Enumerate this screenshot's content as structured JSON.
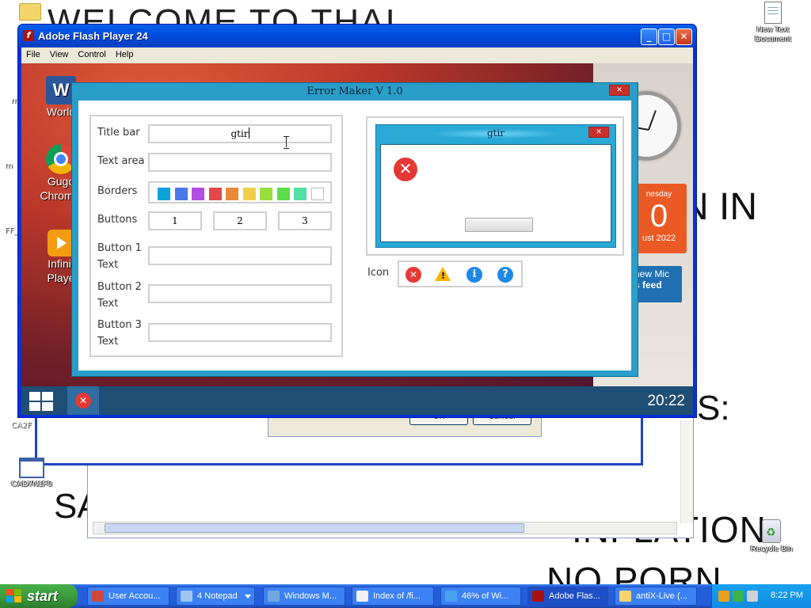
{
  "desktop": {
    "bg_text_top": "WELCOME TO THAI",
    "bg_text_in": "N IN",
    "bg_text_s": "S:",
    "bg_text_sa": "SA",
    "bg_text_inflation": "INFLATION",
    "bg_text_porn": "NO  PORN",
    "icons": {
      "new_text_document": "New Text Document",
      "cad_top": "CA2F",
      "cad": "CAD7N1F9",
      "recycle_bin": "Recycle Bin",
      "edge_m": "m",
      "edge_ff": "FF_"
    }
  },
  "background_dialog": {
    "ok_label": "OK",
    "cancel_label": "Cancel"
  },
  "flash_window": {
    "title": "Adobe Flash Player 24",
    "icon": "f",
    "menu": [
      "File",
      "View",
      "Control",
      "Help"
    ],
    "controls": {
      "minimize": "_",
      "maximize": "□",
      "close": "✕"
    },
    "stage": {
      "word_label": "World",
      "chrome_label": "Gugo Chromiu",
      "player_label": "Infinit Playe",
      "calendar_day": "nesday",
      "calendar_num": "0",
      "calendar_month": "ust 2022",
      "feed_line1": "new Mic",
      "feed_line2": "s feed",
      "time": "20:22"
    }
  },
  "error_maker": {
    "title": "Error Maker V 1.0",
    "close": "✕",
    "labels": {
      "title_bar": "Title bar",
      "text_area": "Text area",
      "borders": "Borders",
      "buttons": "Buttons",
      "button1_text": "Button 1\nText",
      "button2_text": "Button 2\nText",
      "button3_text": "Button 3\nText",
      "icon": "Icon"
    },
    "title_bar_value": "gtir",
    "text_area_value": "",
    "button_counts": [
      "1",
      "2",
      "3"
    ],
    "border_colors": [
      "#0aa2d8",
      "#4a78e8",
      "#b34ce0",
      "#e24848",
      "#e88a3a",
      "#f0cf48",
      "#9ade3a",
      "#5ddc4a",
      "#54e0a4",
      "#ffffff"
    ],
    "button1_value": "",
    "button2_value": "",
    "button3_value": "",
    "preview": {
      "title": "gtir",
      "close": "✕",
      "icon": "error-icon"
    },
    "icon_options": [
      "error-icon",
      "warning-icon",
      "info-icon",
      "question-icon"
    ]
  },
  "taskbar": {
    "start_label": "start",
    "items": [
      {
        "label": "User Accou...",
        "icon": "users-icon"
      },
      {
        "label": "4 Notepad",
        "icon": "notepad-icon"
      },
      {
        "label": "Windows M...",
        "icon": "media-icon"
      },
      {
        "label": "Index of /fi...",
        "icon": "page-icon"
      },
      {
        "label": "46% of Wi...",
        "icon": "ie-icon"
      },
      {
        "label": "Adobe Flas...",
        "icon": "flash-icon"
      },
      {
        "label": "antiX-Live (...",
        "icon": "folder-icon"
      }
    ],
    "clock": "8:22 PM"
  }
}
